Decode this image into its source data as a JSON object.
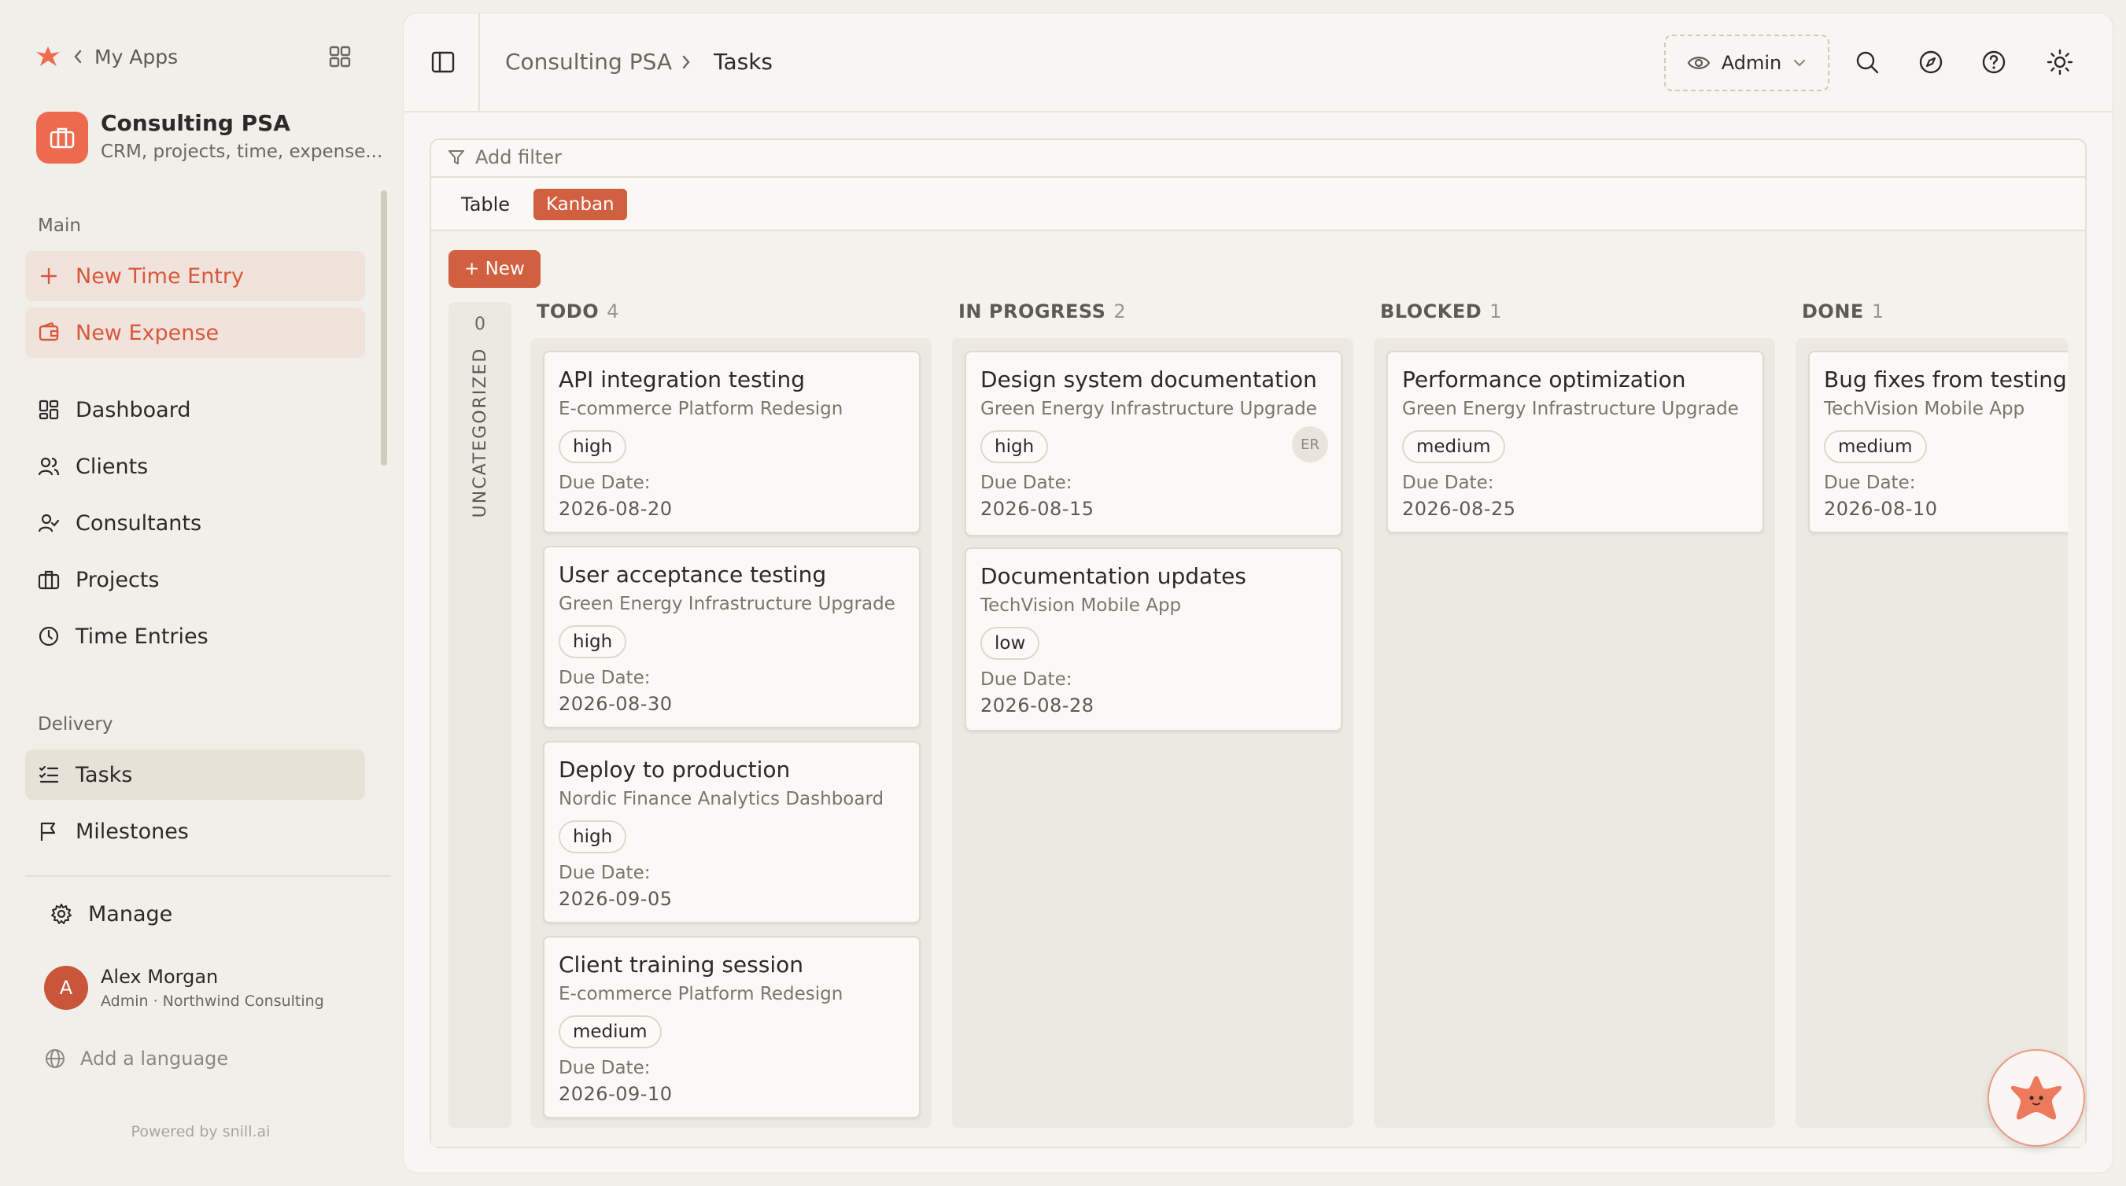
{
  "sidebar": {
    "back_label": "My Apps",
    "app": {
      "name": "Consulting PSA",
      "description": "CRM, projects, time, expense..."
    },
    "main_label": "Main",
    "actions": [
      {
        "label": "New Time Entry",
        "icon": "plus-icon"
      },
      {
        "label": "New Expense",
        "icon": "wallet-icon"
      }
    ],
    "main_items": [
      {
        "label": "Dashboard",
        "icon": "dashboard-icon"
      },
      {
        "label": "Clients",
        "icon": "users-icon"
      },
      {
        "label": "Consultants",
        "icon": "user-check-icon"
      },
      {
        "label": "Projects",
        "icon": "briefcase-icon"
      },
      {
        "label": "Time Entries",
        "icon": "clock-icon"
      }
    ],
    "delivery_label": "Delivery",
    "delivery_items": [
      {
        "label": "Tasks",
        "icon": "list-checks-icon",
        "active": true
      },
      {
        "label": "Milestones",
        "icon": "flag-icon"
      }
    ],
    "manage_label": "Manage",
    "user": {
      "initial": "A",
      "name": "Alex Morgan",
      "role": "Admin · Northwind Consulting"
    },
    "add_language": "Add a language",
    "powered_by": "Powered by snill.ai"
  },
  "header": {
    "breadcrumb": [
      "Consulting PSA",
      "Tasks"
    ],
    "role_select": "Admin"
  },
  "toolbar": {
    "add_filter": "Add filter",
    "views": [
      "Table",
      "Kanban"
    ],
    "active_view": "Kanban",
    "new_label": "+ New"
  },
  "board": {
    "uncategorized": {
      "label": "UNCATEGORIZED",
      "count": "0"
    },
    "due_label": "Due Date:",
    "columns": [
      {
        "name": "TODO",
        "count": "4",
        "cards": [
          {
            "title": "API integration testing",
            "project": "E-commerce Platform Redesign",
            "priority": "high",
            "due": "2026-08-20"
          },
          {
            "title": "User acceptance testing",
            "project": "Green Energy Infrastructure Upgrade",
            "priority": "high",
            "due": "2026-08-30"
          },
          {
            "title": "Deploy to production",
            "project": "Nordic Finance Analytics Dashboard",
            "priority": "high",
            "due": "2026-09-05"
          },
          {
            "title": "Client training session",
            "project": "E-commerce Platform Redesign",
            "priority": "medium",
            "due": "2026-09-10"
          }
        ]
      },
      {
        "name": "IN PROGRESS",
        "count": "2",
        "cards": [
          {
            "title": "Design system documentation",
            "project": "Green Energy Infrastructure Upgrade",
            "priority": "high",
            "due": "2026-08-15",
            "assignee": "ER"
          },
          {
            "title": "Documentation updates",
            "project": "TechVision Mobile App",
            "priority": "low",
            "due": "2026-08-28"
          }
        ]
      },
      {
        "name": "BLOCKED",
        "count": "1",
        "cards": [
          {
            "title": "Performance optimization",
            "project": "Green Energy Infrastructure Upgrade",
            "priority": "medium",
            "due": "2026-08-25"
          }
        ]
      },
      {
        "name": "DONE",
        "count": "1",
        "cards": [
          {
            "title": "Bug fixes from testing",
            "project": "TechVision Mobile App",
            "priority": "medium",
            "due": "2026-08-10"
          }
        ]
      }
    ]
  },
  "colors": {
    "accent": "#d0603f",
    "brand": "#ee6a4e",
    "background": "#f1efe9"
  }
}
